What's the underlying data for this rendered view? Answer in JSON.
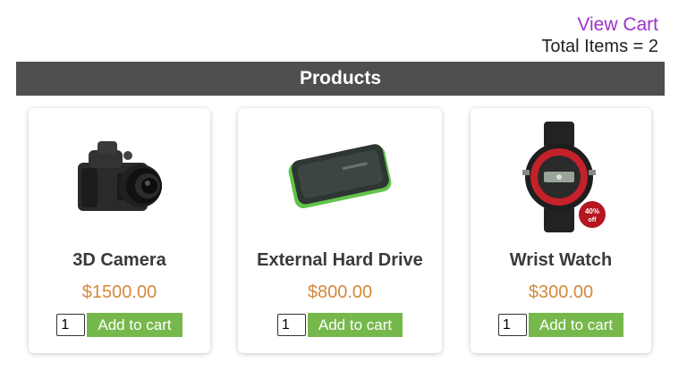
{
  "cart": {
    "view_label": "View Cart",
    "total_label": "Total Items = 2"
  },
  "header": {
    "title": "Products"
  },
  "products": [
    {
      "name": "3D Camera",
      "price": "$1500.00",
      "qty": "1",
      "button_label": "Add to cart",
      "icon": "camera-image"
    },
    {
      "name": "External Hard Drive",
      "price": "$800.00",
      "qty": "1",
      "button_label": "Add to cart",
      "icon": "hard-drive-image"
    },
    {
      "name": "Wrist Watch",
      "price": "$300.00",
      "qty": "1",
      "button_label": "Add to cart",
      "icon": "wrist-watch-image",
      "badge": {
        "line1": "40%",
        "line2": "off"
      }
    }
  ],
  "colors": {
    "link": "#9b32c8",
    "header_bg": "#4f4f4f",
    "price": "#d4893a",
    "button": "#77b84c"
  }
}
